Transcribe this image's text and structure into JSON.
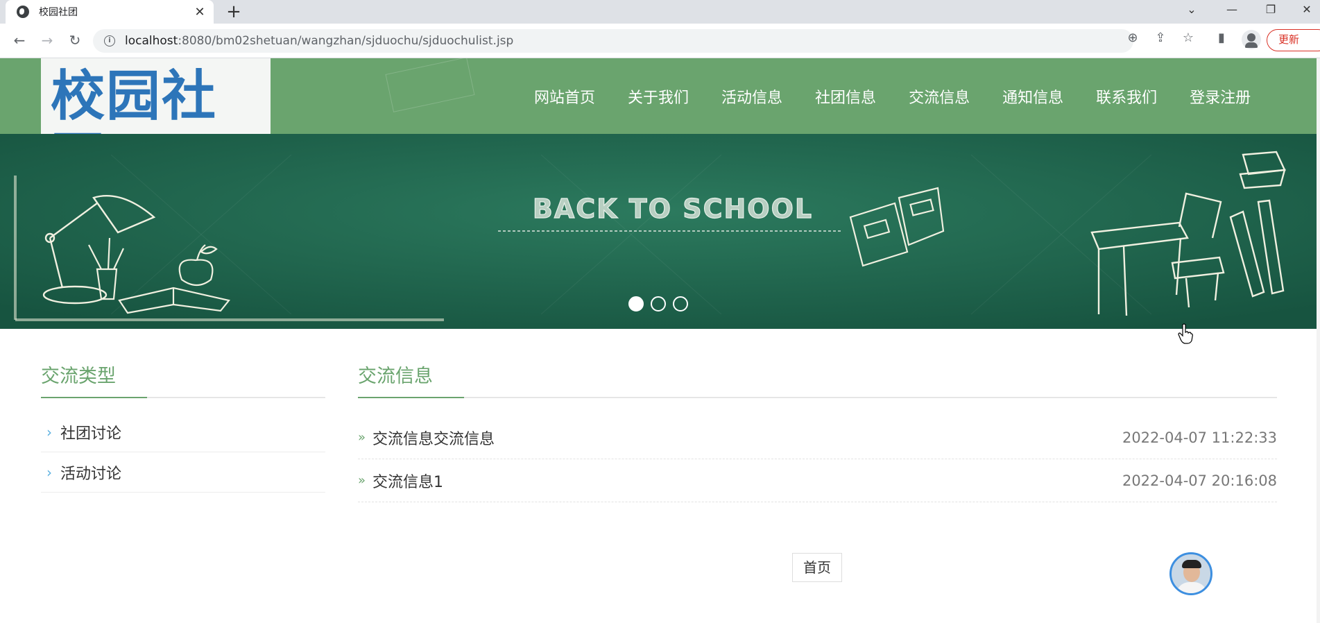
{
  "browser": {
    "tab_title": "校园社团",
    "tab_close": "✕",
    "new_tab": "+",
    "url_host": "localhost",
    "url_path": ":8080/bm02shetuan/wangzhan/sjduochu/sjduochulist.jsp",
    "update_label": "更新"
  },
  "header": {
    "logo": "校园社团",
    "nav": [
      "网站首页",
      "关于我们",
      "活动信息",
      "社团信息",
      "交流信息",
      "通知信息",
      "联系我们",
      "登录注册"
    ]
  },
  "banner": {
    "title": "BACK TO SCHOOL"
  },
  "sidebar": {
    "title": "交流类型",
    "items": [
      "社团讨论",
      "活动讨论"
    ]
  },
  "main": {
    "title": "交流信息",
    "rows": [
      {
        "title": "交流信息交流信息",
        "time": "2022-04-07 11:22:33"
      },
      {
        "title": "交流信息1",
        "time": "2022-04-07 20:16:08"
      }
    ],
    "pager_label": "首页"
  }
}
